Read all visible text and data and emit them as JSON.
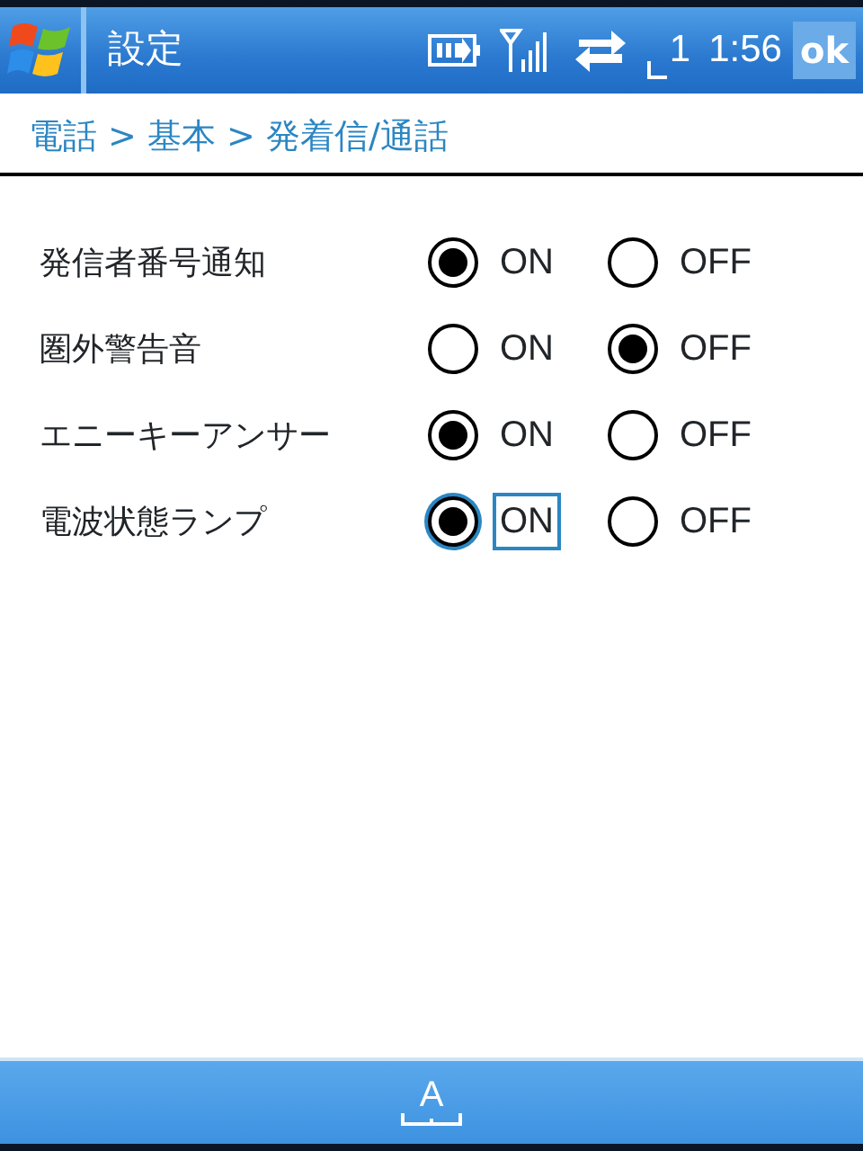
{
  "title_bar": {
    "title": "設定",
    "line_number": "1",
    "time": "1:56",
    "ok_button": "ok"
  },
  "breadcrumb": "電話 > 基本 > 発着信/通話",
  "settings": [
    {
      "label": "発信者番号通知",
      "options": [
        {
          "label": "ON",
          "selected": true,
          "focused": false
        },
        {
          "label": "OFF",
          "selected": false,
          "focused": false
        }
      ]
    },
    {
      "label": "圏外警告音",
      "options": [
        {
          "label": "ON",
          "selected": false,
          "focused": false
        },
        {
          "label": "OFF",
          "selected": true,
          "focused": false
        }
      ]
    },
    {
      "label": "エニーキーアンサー",
      "options": [
        {
          "label": "ON",
          "selected": true,
          "focused": false
        },
        {
          "label": "OFF",
          "selected": false,
          "focused": false
        }
      ]
    },
    {
      "label": "電波状態ランプ",
      "options": [
        {
          "label": "ON",
          "selected": true,
          "focused": true
        },
        {
          "label": "OFF",
          "selected": false,
          "focused": false
        }
      ]
    }
  ],
  "menu_bar": {
    "input_panel": "A"
  }
}
